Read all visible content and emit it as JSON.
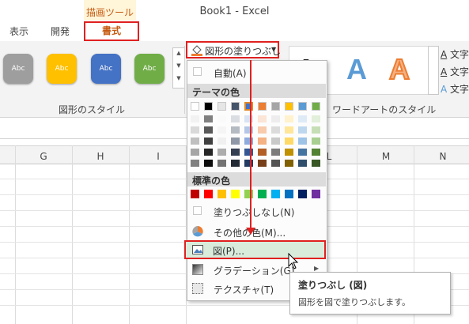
{
  "window": {
    "title": "Book1 - Excel",
    "context_tab_group": "描画ツール"
  },
  "tabs": [
    {
      "label": "表示"
    },
    {
      "label": "開発"
    },
    {
      "label": "書式",
      "active": true
    }
  ],
  "ribbon": {
    "shape_styles_label": "図形のスタイル",
    "shape_style_presets": [
      {
        "text": "Abc",
        "color": "#9e9e9e"
      },
      {
        "text": "Abc",
        "color": "#ffc000"
      },
      {
        "text": "Abc",
        "color": "#4472c4"
      },
      {
        "text": "Abc",
        "color": "#70ad47"
      }
    ],
    "fill_button_label": "図形の塗りつぶし",
    "wordart_styles_label": "ワードアートのスタイル",
    "wordart_side_items": [
      "文字",
      "文字",
      "文字"
    ]
  },
  "columns": [
    "G",
    "H",
    "I",
    "L",
    "M",
    "N"
  ],
  "fill_menu": {
    "auto_label": "自動(A)",
    "theme_colors_label": "テーマの色",
    "theme_colors": [
      "#ffffff",
      "#000000",
      "#e7e6e6",
      "#44546a",
      "#4472c4",
      "#ed7d31",
      "#a5a5a5",
      "#ffc000",
      "#5b9bd5",
      "#70ad47"
    ],
    "standard_colors_label": "標準の色",
    "standard_colors": [
      "#c00000",
      "#ff0000",
      "#ffc000",
      "#ffff00",
      "#92d050",
      "#00b050",
      "#00b0f0",
      "#0070c0",
      "#002060",
      "#7030a0"
    ],
    "no_fill_label": "塗りつぶしなし(N)",
    "more_colors_label": "その他の色(M)...",
    "picture_label": "図(P)...",
    "gradient_label": "グラデーション(G)",
    "texture_label": "テクスチャ(T)"
  },
  "tooltip": {
    "title": "塗りつぶし (図)",
    "description": "図形を図で塗りつぶします。"
  },
  "colors": {
    "accent": "#e02020",
    "context": "#c55a11",
    "highlight": "#d9ecdc"
  }
}
